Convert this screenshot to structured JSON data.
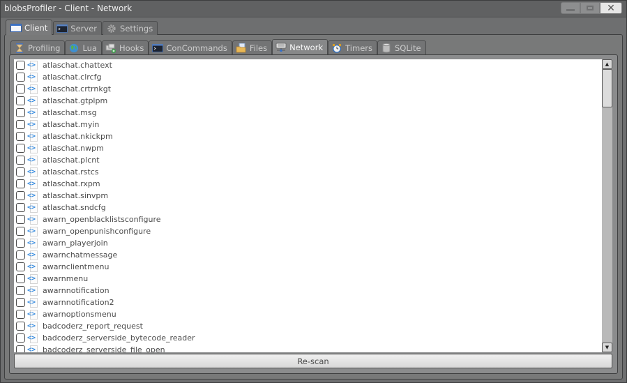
{
  "window": {
    "title": "blobsProfiler - Client - Network",
    "controls": [
      "minimize",
      "maximize",
      "close"
    ]
  },
  "outer_tabs": [
    {
      "label": "Client",
      "icon": "window-icon",
      "active": true
    },
    {
      "label": "Server",
      "icon": "terminal-icon",
      "active": false
    },
    {
      "label": "Settings",
      "icon": "gear-icon",
      "active": false
    }
  ],
  "inner_tabs": [
    {
      "label": "Profiling",
      "icon": "hourglass-icon",
      "active": false
    },
    {
      "label": "Lua",
      "icon": "globe-icon",
      "active": false
    },
    {
      "label": "Hooks",
      "icon": "hooks-icon",
      "active": false
    },
    {
      "label": "ConCommands",
      "icon": "terminal-icon",
      "active": false
    },
    {
      "label": "Files",
      "icon": "folder-icon",
      "active": false
    },
    {
      "label": "Network",
      "icon": "network-icon",
      "active": true
    },
    {
      "label": "Timers",
      "icon": "clock-icon",
      "active": false
    },
    {
      "label": "SQLite",
      "icon": "database-icon",
      "active": false
    }
  ],
  "network_list": {
    "items": [
      {
        "name": "atlaschat.chattext",
        "checked": false
      },
      {
        "name": "atlaschat.clrcfg",
        "checked": false
      },
      {
        "name": "atlaschat.crtrnkgt",
        "checked": false
      },
      {
        "name": "atlaschat.gtplpm",
        "checked": false
      },
      {
        "name": "atlaschat.msg",
        "checked": false
      },
      {
        "name": "atlaschat.myin",
        "checked": false
      },
      {
        "name": "atlaschat.nkickpm",
        "checked": false
      },
      {
        "name": "atlaschat.nwpm",
        "checked": false
      },
      {
        "name": "atlaschat.plcnt",
        "checked": false
      },
      {
        "name": "atlaschat.rstcs",
        "checked": false
      },
      {
        "name": "atlaschat.rxpm",
        "checked": false
      },
      {
        "name": "atlaschat.sinvpm",
        "checked": false
      },
      {
        "name": "atlaschat.sndcfg",
        "checked": false
      },
      {
        "name": "awarn_openblacklistsconfigure",
        "checked": false
      },
      {
        "name": "awarn_openpunishconfigure",
        "checked": false
      },
      {
        "name": "awarn_playerjoin",
        "checked": false
      },
      {
        "name": "awarnchatmessage",
        "checked": false
      },
      {
        "name": "awarnclientmenu",
        "checked": false
      },
      {
        "name": "awarnmenu",
        "checked": false
      },
      {
        "name": "awarnnotification",
        "checked": false
      },
      {
        "name": "awarnnotification2",
        "checked": false
      },
      {
        "name": "awarnoptionsmenu",
        "checked": false
      },
      {
        "name": "badcoderz_report_request",
        "checked": false
      },
      {
        "name": "badcoderz_serverside_bytecode_reader",
        "checked": false
      },
      {
        "name": "badcoderz_serverside_file_open",
        "checked": false
      }
    ],
    "scroll_position_fraction": 0.0
  },
  "rescan_button": {
    "label": "Re-scan"
  },
  "colors": {
    "window_bg": "#6e6f70",
    "list_bg": "#ffffff",
    "item_text": "#4b4b4b",
    "net_icon": "#3a8de0"
  }
}
